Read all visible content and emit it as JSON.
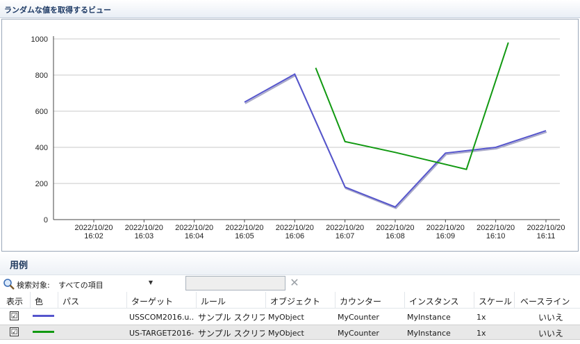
{
  "window": {
    "title": "ランダムな値を取得するビュー"
  },
  "colors": {
    "series1": "#5555cc",
    "series2": "#119911",
    "grid": "#c8c8c8"
  },
  "chart_data": {
    "type": "line",
    "title": "",
    "ylim": [
      0,
      1000
    ],
    "yticks": [
      0,
      200,
      400,
      600,
      800,
      1000
    ],
    "xticks": [
      {
        "date": "2022/10/20",
        "time": "16:02"
      },
      {
        "date": "2022/10/20",
        "time": "16:03"
      },
      {
        "date": "2022/10/20",
        "time": "16:04"
      },
      {
        "date": "2022/10/20",
        "time": "16:05"
      },
      {
        "date": "2022/10/20",
        "time": "16:06"
      },
      {
        "date": "2022/10/20",
        "time": "16:07"
      },
      {
        "date": "2022/10/20",
        "time": "16:08"
      },
      {
        "date": "2022/10/20",
        "time": "16:09"
      },
      {
        "date": "2022/10/20",
        "time": "16:10"
      },
      {
        "date": "2022/10/20",
        "time": "16:11"
      }
    ],
    "series": [
      {
        "color": "#5555cc",
        "points": [
          {
            "x": "2022/10/20 16:05",
            "y": 650
          },
          {
            "x": "2022/10/20 16:06",
            "y": 805
          },
          {
            "x": "2022/10/20 16:07",
            "y": 180
          },
          {
            "x": "2022/10/20 16:08",
            "y": 70
          },
          {
            "x": "2022/10/20 16:09",
            "y": 368
          },
          {
            "x": "2022/10/20 16:10",
            "y": 400
          },
          {
            "x": "2022/10/20 16:11",
            "y": 492
          }
        ]
      },
      {
        "color": "#119911",
        "points": [
          {
            "x": "2022/10/20 16:06:25",
            "y": 840
          },
          {
            "x": "2022/10/20 16:07",
            "y": 432
          },
          {
            "x": "2022/10/20 16:08",
            "y": 372
          },
          {
            "x": "2022/10/20 16:09:25",
            "y": 278
          },
          {
            "x": "2022/10/20 16:10:15",
            "y": 980
          }
        ]
      }
    ],
    "grid": true
  },
  "legend": {
    "title": "用例",
    "filter_label": "検索対象:",
    "filter_value": "すべての項目",
    "search_value": "",
    "columns": [
      "表示",
      "色",
      "パス",
      "ターゲット",
      "ルール",
      "オブジェクト",
      "カウンター",
      "インスタンス",
      "スケール",
      "ベースライン"
    ],
    "rows": [
      {
        "checked": "☑",
        "color": "#5555cc",
        "path": "",
        "target": "USSCOM2016.u...",
        "rule": "サンプル スクリプ...",
        "object": "MyObject",
        "counter": "MyCounter",
        "instance": "MyInstance",
        "scale": "1x",
        "baseline": "いいえ"
      },
      {
        "checked": "☑",
        "color": "#119911",
        "path": "",
        "target": "US-TARGET2016-...",
        "rule": "サンプル スクリプ...",
        "object": "MyObject",
        "counter": "MyCounter",
        "instance": "MyInstance",
        "scale": "1x",
        "baseline": "いいえ"
      }
    ]
  }
}
